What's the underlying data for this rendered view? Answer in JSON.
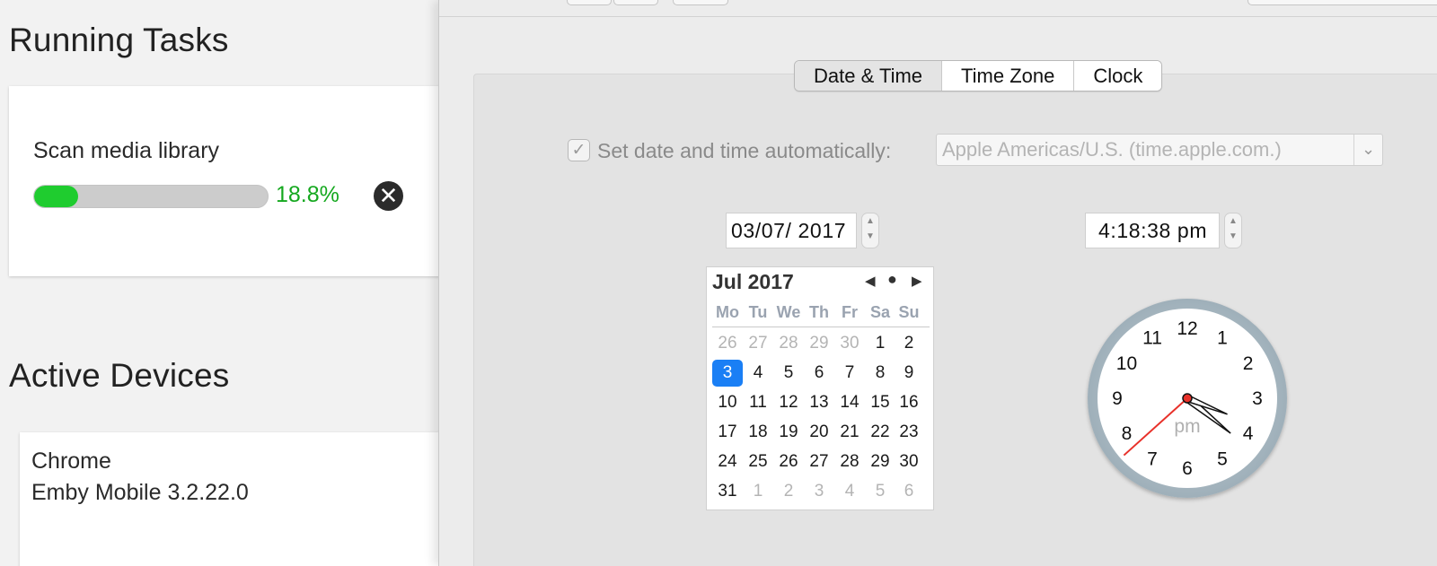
{
  "running_tasks": {
    "title": "Running Tasks",
    "task_name": "Scan media library",
    "progress_percent": 18.8,
    "progress_label": "18.8%",
    "cancel_icon": "close-circle-icon",
    "progress_color": "#1fcc2f",
    "progress_text_color": "#15a81f"
  },
  "active_devices": {
    "title": "Active Devices",
    "device_name": "Chrome",
    "device_app": "Emby Mobile 3.2.22.0"
  },
  "date_time": {
    "tabs": [
      {
        "label": "Date & Time",
        "active": true
      },
      {
        "label": "Time Zone",
        "active": false
      },
      {
        "label": "Clock",
        "active": false
      }
    ],
    "auto_checkbox_checked": true,
    "auto_label": "Set date and time automatically:",
    "server_value": "Apple Americas/U.S. (time.apple.com.)",
    "date_field": "03/07/ 2017",
    "time_field": "4:18:38 pm",
    "calendar": {
      "month_label": "Jul 2017",
      "nav_prev_icon": "triangle-left-icon",
      "nav_today_icon": "dot-icon",
      "nav_next_icon": "triangle-right-icon",
      "weekdays": [
        "Mo",
        "Tu",
        "We",
        "Th",
        "Fr",
        "Sa",
        "Su"
      ],
      "weeks": [
        [
          "26",
          "27",
          "28",
          "29",
          "30",
          "1",
          "2"
        ],
        [
          "3",
          "4",
          "5",
          "6",
          "7",
          "8",
          "9"
        ],
        [
          "10",
          "11",
          "12",
          "13",
          "14",
          "15",
          "16"
        ],
        [
          "17",
          "18",
          "19",
          "20",
          "21",
          "22",
          "23"
        ],
        [
          "24",
          "25",
          "26",
          "27",
          "28",
          "29",
          "30"
        ],
        [
          "31",
          "1",
          "2",
          "3",
          "4",
          "5",
          "6"
        ]
      ],
      "selected_day": "3",
      "selected_color": "#1a7ff5"
    },
    "clock": {
      "numbers": [
        "12",
        "1",
        "2",
        "3",
        "4",
        "5",
        "6",
        "7",
        "8",
        "9",
        "10",
        "11"
      ],
      "period": "pm",
      "hour": 4,
      "minute": 18,
      "second": 38,
      "second_hand_color": "#e8312a"
    }
  }
}
